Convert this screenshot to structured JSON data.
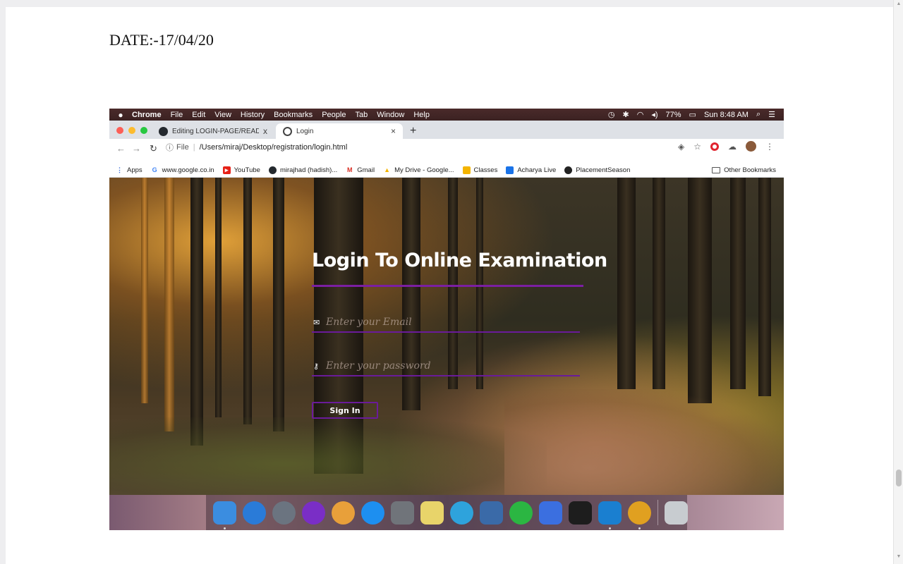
{
  "date_label": "DATE:-17/04/20",
  "menubar": {
    "items": [
      "Chrome",
      "File",
      "Edit",
      "View",
      "History",
      "Bookmarks",
      "People",
      "Tab",
      "Window",
      "Help"
    ],
    "status": {
      "battery": "77%",
      "time": "Sun 8:48 AM"
    }
  },
  "tabs": [
    {
      "label": "Editing LOGIN-PAGE/README.md",
      "icon": "github-icon",
      "close": "x"
    },
    {
      "label": "Login",
      "icon": "globe-icon",
      "close": "×"
    }
  ],
  "new_tab": "+",
  "omnibox": {
    "scheme": "File",
    "separator": "|",
    "url": "/Users/miraj/Desktop/registration/login.html"
  },
  "bookmarks": [
    {
      "label": "Apps",
      "icon": "apps-grid-icon"
    },
    {
      "label": "www.google.co.in",
      "icon": "google-icon"
    },
    {
      "label": "YouTube",
      "icon": "youtube-icon"
    },
    {
      "label": "mirajhad (hadish)...",
      "icon": "github-icon"
    },
    {
      "label": "Gmail",
      "icon": "gmail-icon"
    },
    {
      "label": "My Drive - Google...",
      "icon": "drive-icon"
    },
    {
      "label": "Classes",
      "icon": "classroom-icon"
    },
    {
      "label": "Acharya Live",
      "icon": "acharya-icon"
    },
    {
      "label": "PlacementSeason",
      "icon": "placement-icon"
    }
  ],
  "other_bookmarks": "Other Bookmarks",
  "login": {
    "title": "Login To Online Examination",
    "email_placeholder": "Enter your Email",
    "password_placeholder": "Enter your password",
    "signin_label": "Sign In"
  },
  "dock": [
    {
      "name": "finder-icon",
      "color": "#3b8de0"
    },
    {
      "name": "safari-icon",
      "color": "#2a7bd8"
    },
    {
      "name": "launchpad-icon",
      "color": "#6b7480"
    },
    {
      "name": "podcasts-icon",
      "color": "#7a2ec6"
    },
    {
      "name": "photos-icon",
      "color": "#e8a03a"
    },
    {
      "name": "app-store-icon",
      "color": "#1d8ff0"
    },
    {
      "name": "system-preferences-icon",
      "color": "#70747a"
    },
    {
      "name": "python-icon",
      "color": "#e8d46a"
    },
    {
      "name": "telegram-icon",
      "color": "#2ea3dc"
    },
    {
      "name": "virtualbox-icon",
      "color": "#3a6aa8"
    },
    {
      "name": "whatsapp-icon",
      "color": "#2bb642"
    },
    {
      "name": "wps-icon",
      "color": "#3b6fe0"
    },
    {
      "name": "terminal-icon",
      "color": "#1d1d1d"
    },
    {
      "name": "vscode-icon",
      "color": "#1a7fd0"
    },
    {
      "name": "chrome-icon",
      "color": "#e0a020"
    },
    {
      "name": "trash-icon",
      "color": "#c8ccd0"
    }
  ]
}
